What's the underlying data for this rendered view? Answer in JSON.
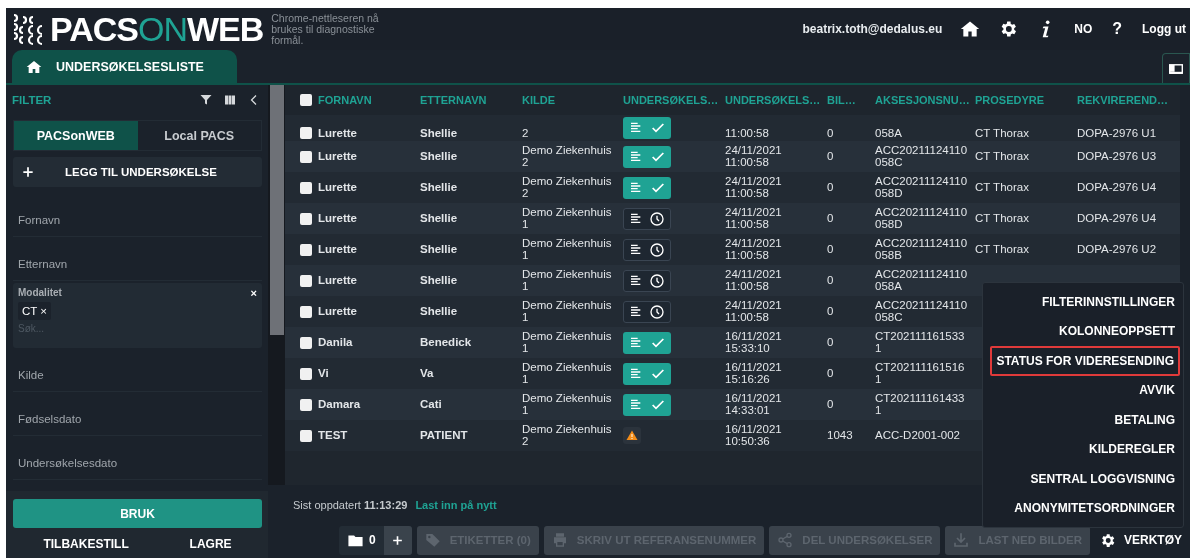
{
  "header": {
    "logo": [
      "PACS",
      "ON",
      "WEB"
    ],
    "notice": "Chrome-nettleseren nå brukes til diagnostiske formål.",
    "user": "beatrix.toth@dedalus.eu",
    "language": "NO",
    "help": "?",
    "logout": "Logg ut"
  },
  "tabs": [
    {
      "label": "UNDERSØKELSESLISTE",
      "selected": true
    }
  ],
  "sidebar": {
    "title": "FILTER",
    "source_tabs": [
      {
        "label": "PACSonWEB",
        "selected": true
      },
      {
        "label": "Local PACS",
        "selected": false
      }
    ],
    "add_button": "LEGG TIL UNDERSØKELSE",
    "fields": [
      {
        "kind": "text",
        "placeholder": "Fornavn"
      },
      {
        "kind": "text",
        "placeholder": "Etternavn"
      },
      {
        "kind": "chips",
        "label": "Modalitet",
        "clear": "×",
        "chips": [
          {
            "label": "CT",
            "remove": "×"
          }
        ],
        "placeholder": "Søk..."
      },
      {
        "kind": "text",
        "placeholder": "Kilde"
      },
      {
        "kind": "text",
        "placeholder": "Fødselsdato"
      },
      {
        "kind": "text",
        "placeholder": "Undersøkelsesdato"
      }
    ],
    "apply": "BRUK",
    "reset": "TILBAKESTILL",
    "save": "LAGRE"
  },
  "table": {
    "header_checked": false,
    "columns": [
      "FORNAVN",
      "ETTERNAVN",
      "KILDE",
      "UNDERSØKELS…",
      "UNDERSØKELS…",
      "BIL…",
      "AKSESJONSNU…",
      "PROSEDYRE",
      "REKVIREREND…"
    ],
    "rows": [
      {
        "checked": false,
        "first": "Lurette",
        "last": "Shellie",
        "source": "2",
        "kind": "done",
        "date": "11:00:58",
        "images": "0",
        "accession": "058A",
        "procedure": "CT Thorax",
        "referrer": "DOPA-2976 U1"
      },
      {
        "checked": false,
        "first": "Lurette",
        "last": "Shellie",
        "source": "Demo Ziekenhuis 2",
        "kind": "done",
        "date": "24/11/2021 11:00:58",
        "images": "0",
        "accession": "ACC20211124110 058C",
        "procedure": "CT Thorax",
        "referrer": "DOPA-2976 U3"
      },
      {
        "checked": false,
        "first": "Lurette",
        "last": "Shellie",
        "source": "Demo Ziekenhuis 2",
        "kind": "done",
        "date": "24/11/2021 11:00:58",
        "images": "0",
        "accession": "ACC20211124110 058D",
        "procedure": "CT Thorax",
        "referrer": "DOPA-2976 U4"
      },
      {
        "checked": false,
        "first": "Lurette",
        "last": "Shellie",
        "source": "Demo Ziekenhuis 1",
        "kind": "pending",
        "date": "24/11/2021 11:00:58",
        "images": "0",
        "accession": "ACC20211124110 058D",
        "procedure": "CT Thorax",
        "referrer": "DOPA-2976 U4"
      },
      {
        "checked": false,
        "first": "Lurette",
        "last": "Shellie",
        "source": "Demo Ziekenhuis 1",
        "kind": "pending",
        "date": "24/11/2021 11:00:58",
        "images": "0",
        "accession": "ACC20211124110 058B",
        "procedure": "CT Thorax",
        "referrer": "DOPA-2976 U2"
      },
      {
        "checked": false,
        "first": "Lurette",
        "last": "Shellie",
        "source": "Demo Ziekenhuis 1",
        "kind": "pending",
        "date": "24/11/2021 11:00:58",
        "images": "0",
        "accession": "ACC20211124110 058A"
      },
      {
        "checked": false,
        "first": "Lurette",
        "last": "Shellie",
        "source": "Demo Ziekenhuis 1",
        "kind": "pending",
        "date": "24/11/2021 11:00:58",
        "images": "0",
        "accession": "ACC20211124110 058C"
      },
      {
        "checked": false,
        "first": "Danila",
        "last": "Benedick",
        "source": "Demo Ziekenhuis 1",
        "kind": "done",
        "date": "16/11/2021 15:33:10",
        "images": "0",
        "accession": "CT202111161533 1"
      },
      {
        "checked": false,
        "first": "Vi",
        "last": "Va",
        "source": "Demo Ziekenhuis 1",
        "kind": "done",
        "date": "16/11/2021 15:16:26",
        "images": "0",
        "accession": "CT202111161516 1"
      },
      {
        "checked": false,
        "first": "Damara",
        "last": "Cati",
        "source": "Demo Ziekenhuis 1",
        "kind": "done",
        "date": "16/11/2021 14:33:01",
        "images": "0",
        "accession": "CT202111161433 1"
      },
      {
        "checked": false,
        "first": "TEST",
        "last": "PATIENT",
        "source": "Demo Ziekenhuis 2",
        "kind": "warning",
        "date": "16/11/2021 10:50:36",
        "images": "1043",
        "accession": "ACC-D2001-002"
      }
    ]
  },
  "footer": {
    "updated": "Sist oppdatert **11:13:29**",
    "reload": "Last inn på nytt"
  },
  "toolbar": {
    "folder_count": "0",
    "buttons": [
      {
        "label": "ETIKETTER (0)",
        "disabled": true
      },
      {
        "label": "SKRIV UT REFERANSENUMMER",
        "disabled": true
      },
      {
        "label": "DEL UNDERSØKELSER",
        "disabled": true
      },
      {
        "label": "LAST NED BILDER",
        "disabled": true
      }
    ],
    "tools": "VERKTØY"
  },
  "menu": {
    "items": [
      {
        "label": "FILTERINNSTILLINGER",
        "highlighted": false
      },
      {
        "label": "KOLONNEOPPSETT",
        "highlighted": false
      },
      {
        "label": "STATUS FOR VIDERESENDING",
        "highlighted": true
      },
      {
        "label": "AVVIK",
        "highlighted": false
      },
      {
        "label": "BETALING",
        "highlighted": false
      },
      {
        "label": "KILDEREGLER",
        "highlighted": false
      },
      {
        "label": "SENTRAL LOGGVISNING",
        "highlighted": false
      },
      {
        "label": "ANONYMITETSORDNINGER",
        "highlighted": false
      }
    ]
  }
}
